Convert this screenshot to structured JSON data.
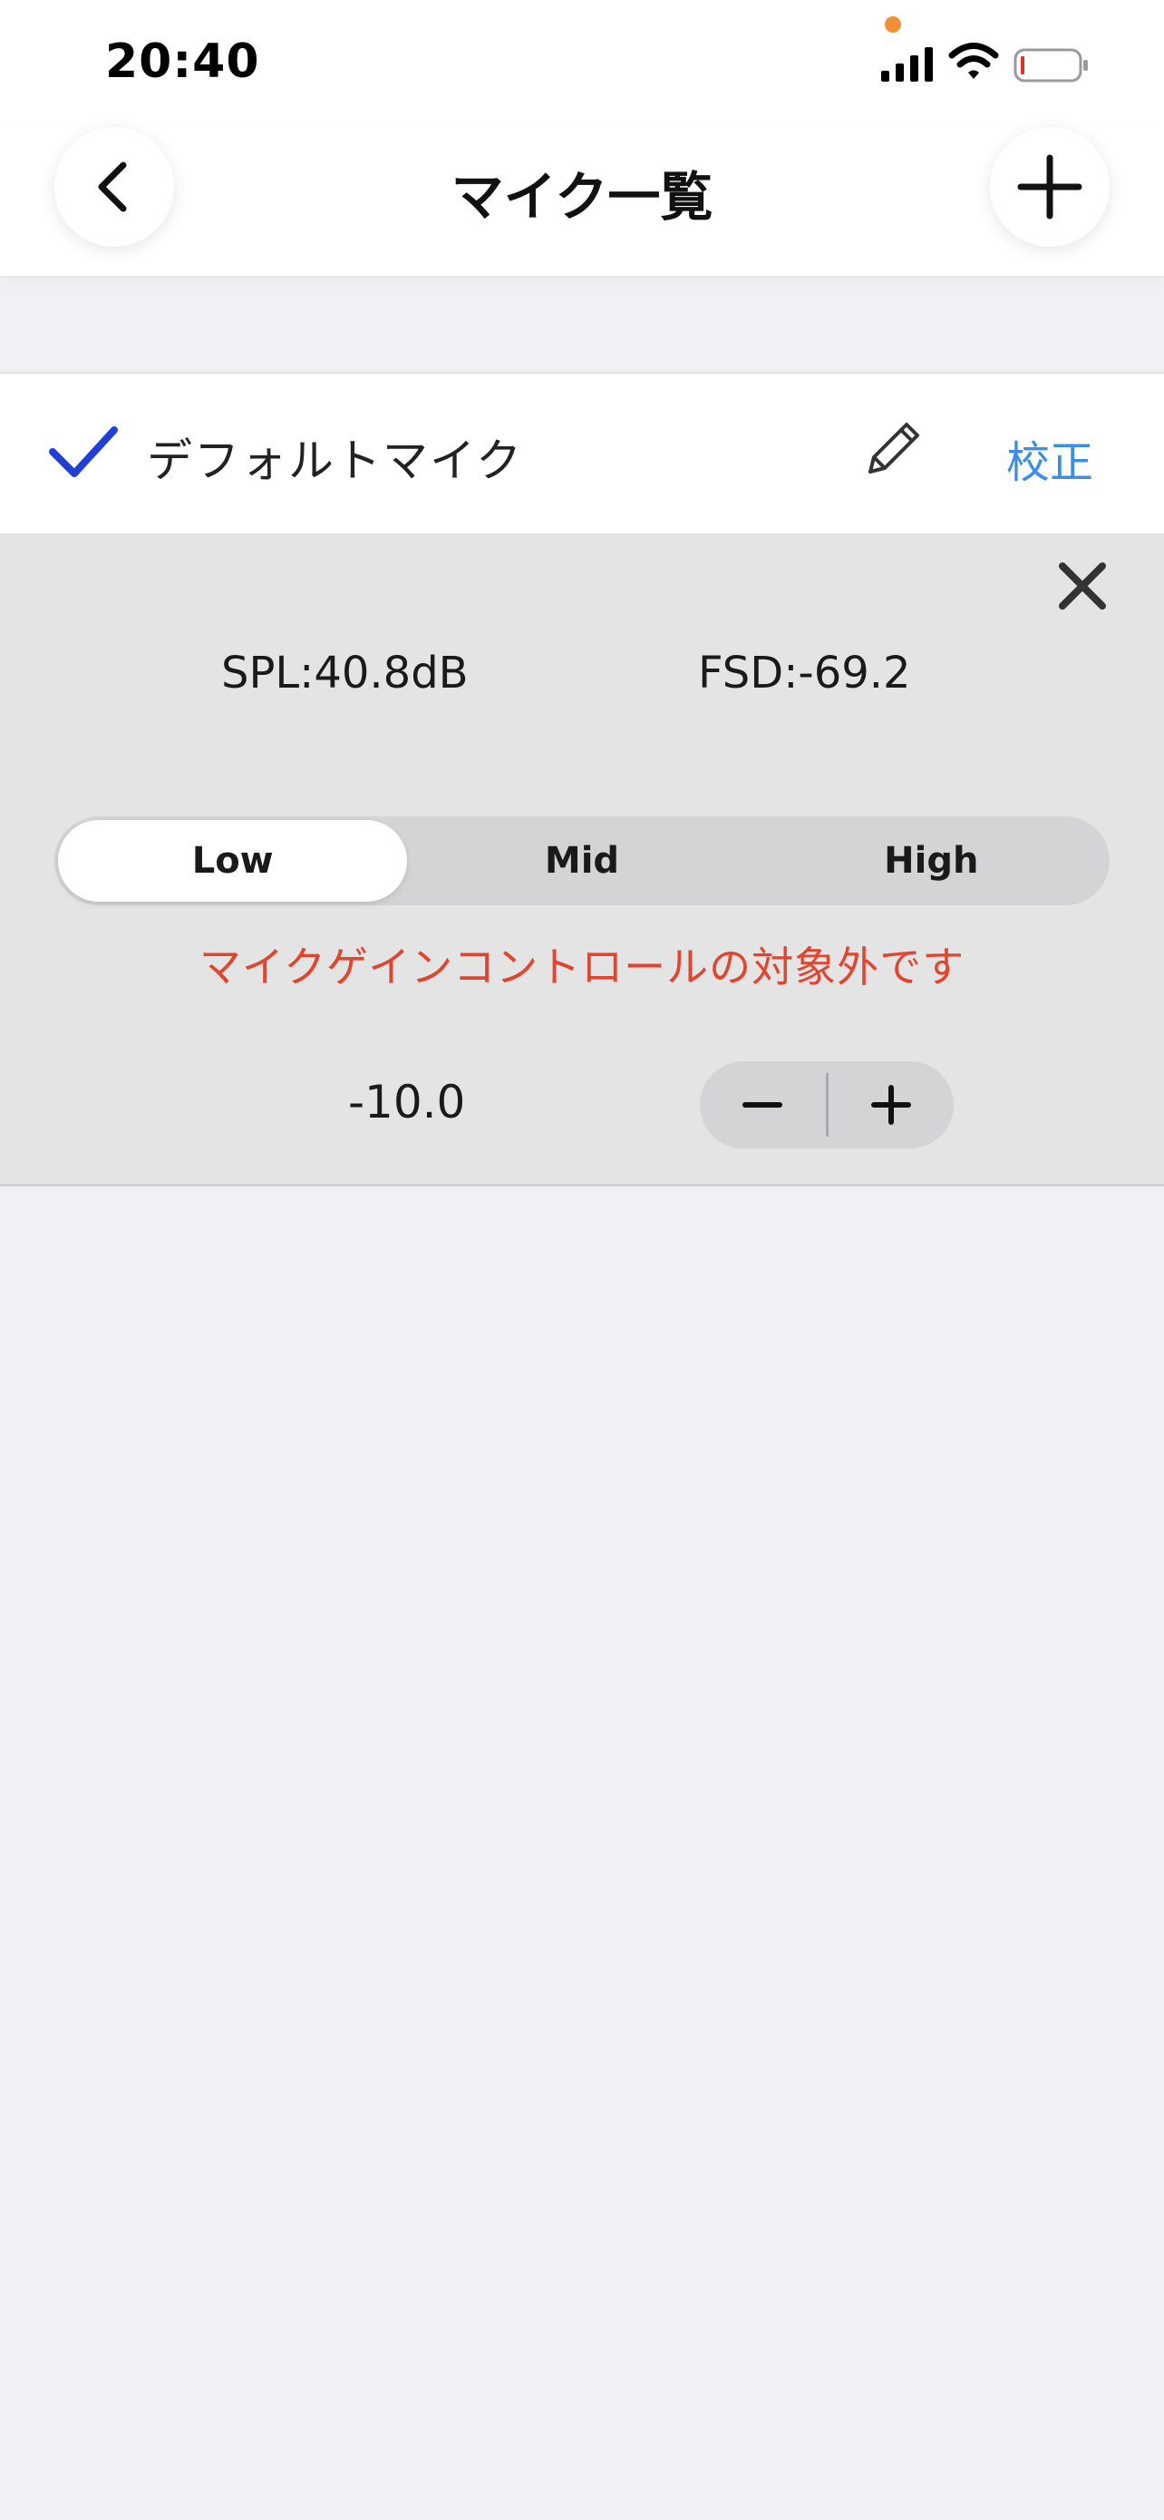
{
  "status_bar": {
    "time": "20:40",
    "icons": [
      "privacy-indicator-dot",
      "cellular-signal-icon",
      "wifi-icon",
      "battery-low-icon"
    ],
    "privacy_dot_color": "#f0903a",
    "battery_level_fraction": 0.05
  },
  "nav": {
    "title": "マイク一覧",
    "back_icon": "chevron-left-icon",
    "add_icon": "plus-icon"
  },
  "mic_list": {
    "items": [
      {
        "name": "デフォルトマイク",
        "selected": true,
        "check_color": "#1f3fd6",
        "edit_icon": "pencil-icon",
        "calibrate_label": "校正"
      }
    ]
  },
  "detail_panel": {
    "close_icon": "close-x-icon",
    "spl": "SPL:40.8dB",
    "fsd": "FSD:-69.2",
    "gain_options": [
      "Low",
      "Mid",
      "High"
    ],
    "selected_gain": "Low",
    "warning": "マイクゲインコントロールの対象外です",
    "warning_color": "#e0452f",
    "gain_value": "-10.0",
    "stepper": {
      "decrement_icon": "minus-icon",
      "increment_icon": "plus-icon"
    }
  },
  "colors": {
    "accent_link": "#3a8ee6",
    "background": "#f0f0f5",
    "panel": "#e4e4e4"
  }
}
